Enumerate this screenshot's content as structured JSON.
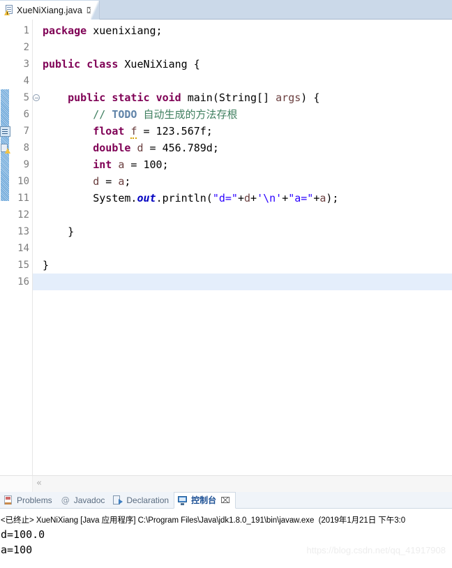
{
  "editor_tab": {
    "label": "XueNiXiang.java",
    "icon": "java-file-warning-icon",
    "close_icon": "⌧"
  },
  "editor": {
    "line_numbers": [
      "1",
      "2",
      "3",
      "4",
      "5",
      "6",
      "7",
      "8",
      "9",
      "10",
      "11",
      "12",
      "13",
      "14",
      "15",
      "16"
    ],
    "current_line": 16,
    "fold_marker_line": 5,
    "gutter_markers": [
      {
        "line": 6,
        "type": "todo-marker-icon"
      },
      {
        "line": 7,
        "type": "warning-marker-icon"
      }
    ],
    "lines": [
      {
        "n": 1,
        "segments": [
          {
            "t": "package",
            "c": "kw"
          },
          {
            "t": " xuenixiang;",
            "c": ""
          }
        ]
      },
      {
        "n": 2,
        "segments": []
      },
      {
        "n": 3,
        "segments": [
          {
            "t": "public",
            "c": "kw"
          },
          {
            "t": " ",
            "c": ""
          },
          {
            "t": "class",
            "c": "kw"
          },
          {
            "t": " XueNiXiang {",
            "c": ""
          }
        ]
      },
      {
        "n": 4,
        "segments": []
      },
      {
        "n": 5,
        "segments": [
          {
            "t": "    ",
            "c": ""
          },
          {
            "t": "public",
            "c": "kw"
          },
          {
            "t": " ",
            "c": ""
          },
          {
            "t": "static",
            "c": "kw"
          },
          {
            "t": " ",
            "c": ""
          },
          {
            "t": "void",
            "c": "kw"
          },
          {
            "t": " main(String[] ",
            "c": ""
          },
          {
            "t": "args",
            "c": "var"
          },
          {
            "t": ") {",
            "c": ""
          }
        ]
      },
      {
        "n": 6,
        "segments": [
          {
            "t": "        ",
            "c": ""
          },
          {
            "t": "// ",
            "c": "cmt"
          },
          {
            "t": "TODO",
            "c": "todo"
          },
          {
            "t": " 自动生成的方法存根",
            "c": "cmt"
          }
        ]
      },
      {
        "n": 7,
        "segments": [
          {
            "t": "        ",
            "c": ""
          },
          {
            "t": "float",
            "c": "kw"
          },
          {
            "t": " ",
            "c": ""
          },
          {
            "t": "f",
            "c": "var squig"
          },
          {
            "t": " = 123.567f;",
            "c": ""
          }
        ]
      },
      {
        "n": 8,
        "segments": [
          {
            "t": "        ",
            "c": ""
          },
          {
            "t": "double",
            "c": "kw"
          },
          {
            "t": " ",
            "c": ""
          },
          {
            "t": "d",
            "c": "var"
          },
          {
            "t": " = 456.789d;",
            "c": ""
          }
        ]
      },
      {
        "n": 9,
        "segments": [
          {
            "t": "        ",
            "c": ""
          },
          {
            "t": "int",
            "c": "kw"
          },
          {
            "t": " ",
            "c": ""
          },
          {
            "t": "a",
            "c": "var"
          },
          {
            "t": " = 100;",
            "c": ""
          }
        ]
      },
      {
        "n": 10,
        "segments": [
          {
            "t": "        ",
            "c": ""
          },
          {
            "t": "d",
            "c": "var"
          },
          {
            "t": " = ",
            "c": ""
          },
          {
            "t": "a",
            "c": "var"
          },
          {
            "t": ";",
            "c": ""
          }
        ]
      },
      {
        "n": 11,
        "segments": [
          {
            "t": "        System.",
            "c": ""
          },
          {
            "t": "out",
            "c": "sfld"
          },
          {
            "t": ".println(",
            "c": ""
          },
          {
            "t": "\"d=\"",
            "c": "str"
          },
          {
            "t": "+",
            "c": ""
          },
          {
            "t": "d",
            "c": "var"
          },
          {
            "t": "+",
            "c": ""
          },
          {
            "t": "'\\n'",
            "c": "str"
          },
          {
            "t": "+",
            "c": ""
          },
          {
            "t": "\"a=\"",
            "c": "str"
          },
          {
            "t": "+",
            "c": ""
          },
          {
            "t": "a",
            "c": "var"
          },
          {
            "t": ");",
            "c": ""
          }
        ]
      },
      {
        "n": 12,
        "segments": []
      },
      {
        "n": 13,
        "segments": [
          {
            "t": "    }",
            "c": ""
          }
        ]
      },
      {
        "n": 14,
        "segments": []
      },
      {
        "n": 15,
        "segments": [
          {
            "t": "}",
            "c": ""
          }
        ]
      },
      {
        "n": 16,
        "segments": []
      }
    ],
    "hscroll_left_arrow": "«"
  },
  "bottom_tabs": [
    {
      "label": "Problems",
      "icon": "problems-icon",
      "active": false
    },
    {
      "label": "Javadoc",
      "icon": "javadoc-icon",
      "active": false
    },
    {
      "label": "Declaration",
      "icon": "declaration-icon",
      "active": false
    },
    {
      "label": "控制台",
      "icon": "console-icon",
      "active": true,
      "close_icon": "⌧"
    }
  ],
  "console": {
    "header": "<已终止> XueNiXiang [Java 应用程序] C:\\Program Files\\Java\\jdk1.8.0_191\\bin\\javaw.exe  (2019年1月21日 下午3:0",
    "output": [
      "d=100.0",
      "a=100"
    ]
  },
  "watermark": "https://blog.csdn.net/qq_41917908",
  "colors": {
    "tabbar_bg": "#cbd9e9",
    "keyword": "#7f0055",
    "string": "#2a00ff",
    "comment": "#3f7f5f",
    "todo": "#5f83a8",
    "static_field": "#0000c0",
    "local_var": "#6a3e3e",
    "current_line": "#e4eefb",
    "change_bar": "#5d9fd6",
    "active_tab_text": "#1b4f94"
  }
}
